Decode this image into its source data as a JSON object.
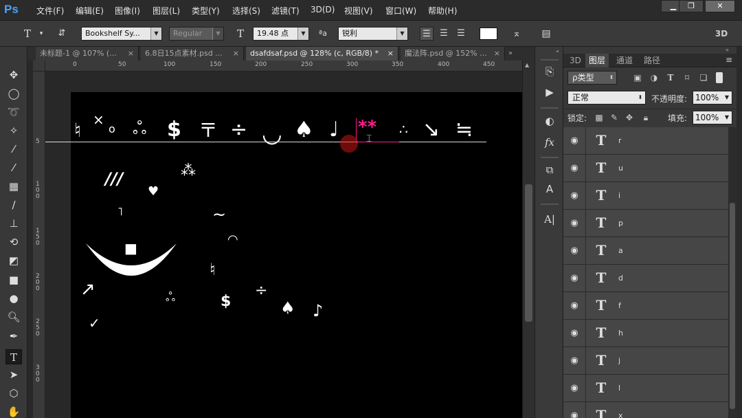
{
  "app": {
    "logo": "Ps"
  },
  "menu": [
    "文件(F)",
    "编辑(E)",
    "图像(I)",
    "图层(L)",
    "类型(Y)",
    "选择(S)",
    "滤镜(T)",
    "3D(D)",
    "视图(V)",
    "窗口(W)",
    "帮助(H)"
  ],
  "window_controls": {
    "minimize": "▁",
    "restore": "❐",
    "close": "✕"
  },
  "options": {
    "font_family": "Bookshelf Sy...",
    "font_style": "Regular",
    "font_size": "19.48 点",
    "antialias_label": "ªa",
    "antialias": "锐利",
    "mode_3d": "3D"
  },
  "doc_tabs": [
    {
      "label": "未标题-1 @ 107% (...",
      "close": "×",
      "active": false
    },
    {
      "label": "6.8日15点素材.psd ...",
      "close": "×",
      "active": false
    },
    {
      "label": "dsafdsaf.psd @ 128% (c, RGB/8) *",
      "close": "×",
      "active": true
    },
    {
      "label": "魔法阵.psd @ 152% ...",
      "close": "×",
      "active": false
    }
  ],
  "ruler": {
    "top": [
      "0",
      "50",
      "100",
      "150",
      "200",
      "250",
      "300",
      "350",
      "400",
      "450"
    ],
    "left": [
      "5",
      "1\n0\n0",
      "1\n5\n0",
      "2\n0\n0",
      "2\n5\n0",
      "3\n0\n0"
    ]
  },
  "canvas_glyphs": {
    "row": [
      "♮",
      "×",
      "o",
      "ஃ",
      "$",
      "〒",
      "÷",
      "◡",
      "♠",
      "♩",
      "**",
      "∴",
      "↘",
      "≒"
    ],
    "scattered": [
      "///",
      "⁂",
      "♥",
      "˥",
      "~",
      "◠",
      "♮",
      "↗",
      "ஃ",
      "$",
      "÷",
      "♠",
      "♪",
      "✓",
      "■"
    ]
  },
  "layers_panel": {
    "tabs": [
      "3D",
      "图层",
      "通道",
      "路径"
    ],
    "filter_kind": "ρ类型",
    "blend_mode": "正常",
    "opacity_label": "不透明度:",
    "opacity": "100%",
    "lock_label": "锁定:",
    "fill_label": "填充:",
    "fill": "100%",
    "layers": [
      {
        "name": "r"
      },
      {
        "name": "u"
      },
      {
        "name": "i"
      },
      {
        "name": "p"
      },
      {
        "name": "a"
      },
      {
        "name": "d"
      },
      {
        "name": "f"
      },
      {
        "name": "h"
      },
      {
        "name": "j"
      },
      {
        "name": "l"
      },
      {
        "name": "x"
      }
    ]
  }
}
